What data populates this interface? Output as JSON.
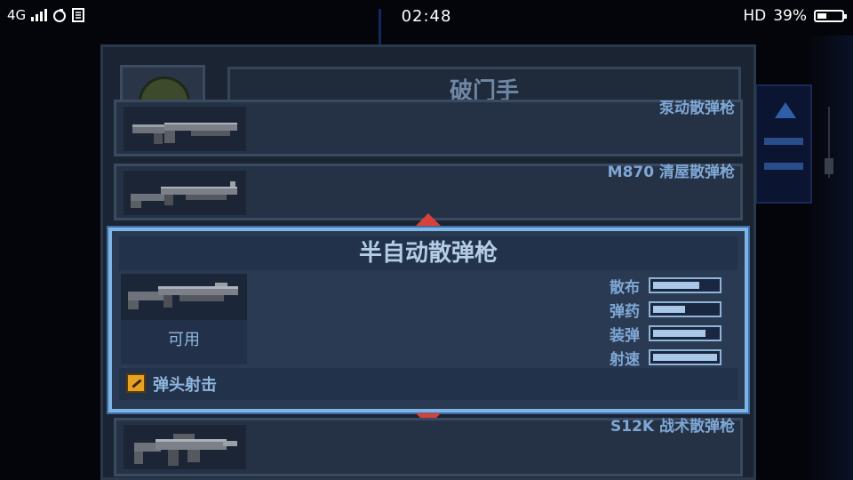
{
  "status_bar": {
    "network": "4G",
    "time": "02:48",
    "hd": "HD",
    "battery": "39%"
  },
  "character": {
    "name": "破门手"
  },
  "weapons": [
    {
      "name": "泵动散弹枪"
    },
    {
      "name": "M870 清屋散弹枪"
    },
    {
      "name": "S12K 战术散弹枪"
    }
  ],
  "selected": {
    "name": "半自动散弹枪",
    "availability": "可用",
    "stats": [
      {
        "label": "散布",
        "value": 0.72
      },
      {
        "label": "弹药",
        "value": 0.5
      },
      {
        "label": "装弹",
        "value": 0.82
      },
      {
        "label": "射速",
        "value": 1.0
      }
    ],
    "perk": "弹头射击"
  },
  "colors": {
    "accent": "#7eb4e6",
    "arrow": "#d8413a",
    "perk_icon": "#e8a221"
  }
}
